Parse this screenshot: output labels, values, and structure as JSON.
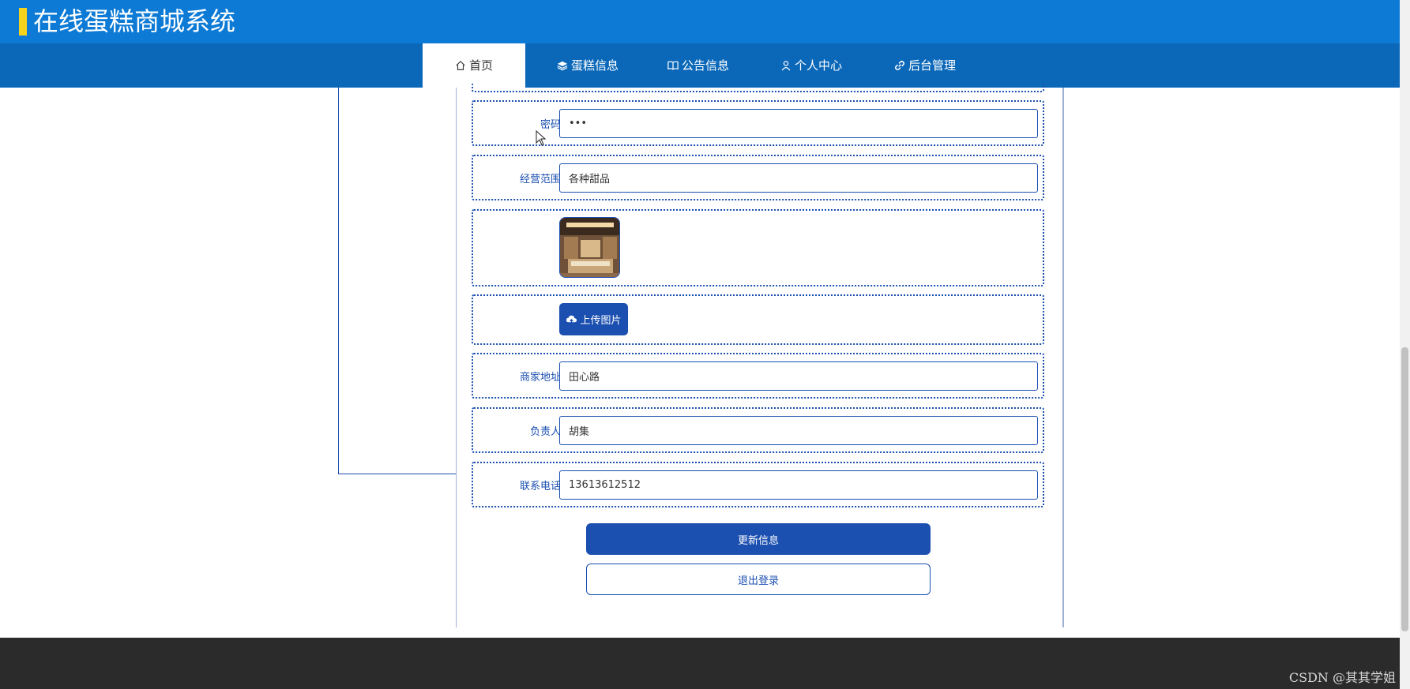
{
  "header": {
    "title": "在线蛋糕商城系统"
  },
  "nav": {
    "items": [
      {
        "label": "首页",
        "icon": "home-icon"
      },
      {
        "label": "蛋糕信息",
        "icon": "layers-icon"
      },
      {
        "label": "公告信息",
        "icon": "book-icon"
      },
      {
        "label": "个人中心",
        "icon": "user-icon"
      },
      {
        "label": "后台管理",
        "icon": "link-icon"
      }
    ]
  },
  "form": {
    "password": {
      "label": "密码",
      "value": "•••"
    },
    "scope": {
      "label": "经营范围",
      "value": "各种甜品"
    },
    "upload": {
      "label": "上传图片",
      "icon": "cloud-upload-icon"
    },
    "address": {
      "label": "商家地址",
      "value": "田心路"
    },
    "manager": {
      "label": "负责人",
      "value": "胡集"
    },
    "phone": {
      "label": "联系电话",
      "value": "13613612512"
    }
  },
  "actions": {
    "update": "更新信息",
    "logout": "退出登录"
  },
  "footer": {
    "watermark": "CSDN @其其学姐"
  },
  "colors": {
    "header": "#0d7bd6",
    "nav": "#0b68b9",
    "accent": "#1b4fb0",
    "title_mark": "#f5d21b",
    "footer": "#2b2b2b"
  }
}
